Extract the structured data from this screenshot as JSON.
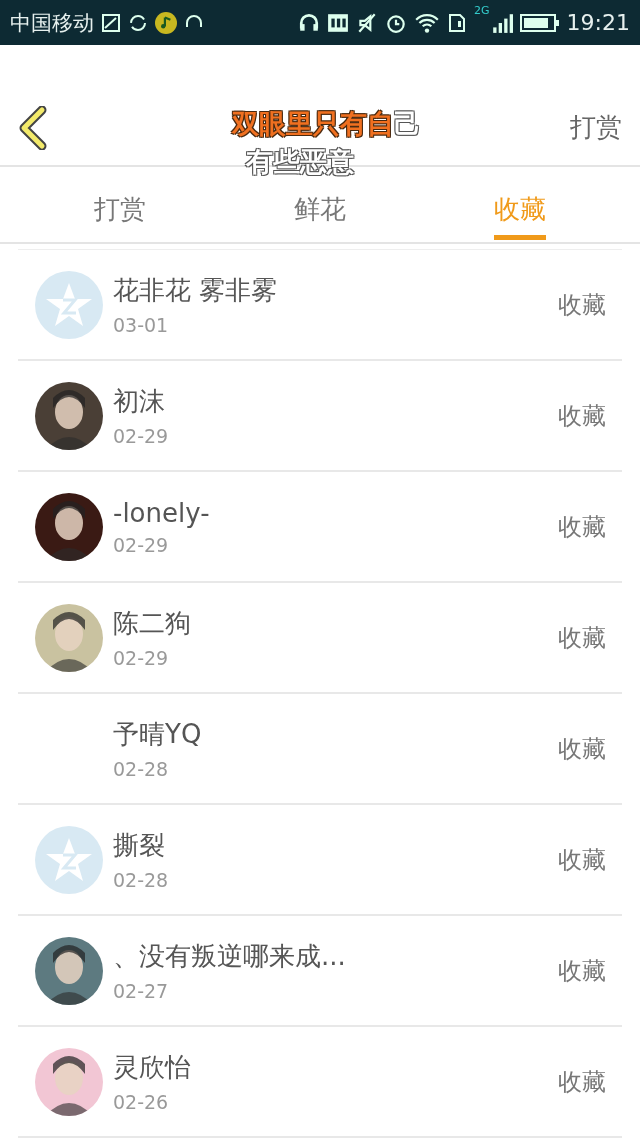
{
  "status_bar": {
    "carrier": "中国移动",
    "time": "19:21",
    "network": "2G"
  },
  "header": {
    "action": "打赏"
  },
  "lyrics": {
    "line1_sung": "双眼里只有自",
    "line1_rest": "己",
    "line2": "有些恶意"
  },
  "tabs": [
    {
      "label": "打赏",
      "selected": false
    },
    {
      "label": "鲜花",
      "selected": false
    },
    {
      "label": "收藏",
      "selected": true
    }
  ],
  "rows": [
    {
      "name": "花非花 雾非雾",
      "date": "03-01",
      "action": "收藏",
      "avatar": {
        "kind": "default"
      }
    },
    {
      "name": "初沫",
      "date": "02-29",
      "action": "收藏"
    },
    {
      "name": "-lonely-",
      "date": "02-29",
      "action": "收藏"
    },
    {
      "name": "陈二狗",
      "date": "02-29",
      "action": "收藏"
    },
    {
      "name": "予晴YQ",
      "date": "02-28",
      "action": "收藏",
      "avatar": {
        "kind": "none"
      }
    },
    {
      "name": "撕裂",
      "date": "02-28",
      "action": "收藏",
      "avatar": {
        "kind": "default"
      }
    },
    {
      "name": "、没有叛逆哪来成...",
      "date": "02-27",
      "action": "收藏"
    },
    {
      "name": "灵欣怡",
      "date": "02-26",
      "action": "收藏"
    }
  ]
}
